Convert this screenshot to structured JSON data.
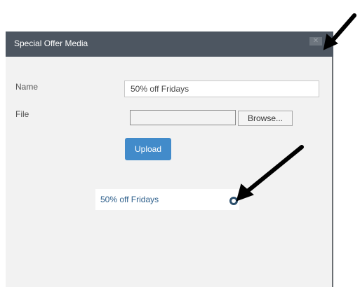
{
  "dialog": {
    "title": "Special Offer Media",
    "close_icon": "close-icon"
  },
  "form": {
    "name_label": "Name",
    "name_value": "50% off Fridays",
    "file_label": "File",
    "browse_label": "Browse...",
    "upload_label": "Upload"
  },
  "media_list": [
    {
      "label": "50% off Fridays",
      "icon": "remove-icon"
    }
  ],
  "annotations": {
    "arrow_color": "#000000",
    "arrow_count": 2
  },
  "colors": {
    "titlebar": "#4d5661",
    "upload_button": "#428bca",
    "dialog_background": "#f2f2f2"
  }
}
